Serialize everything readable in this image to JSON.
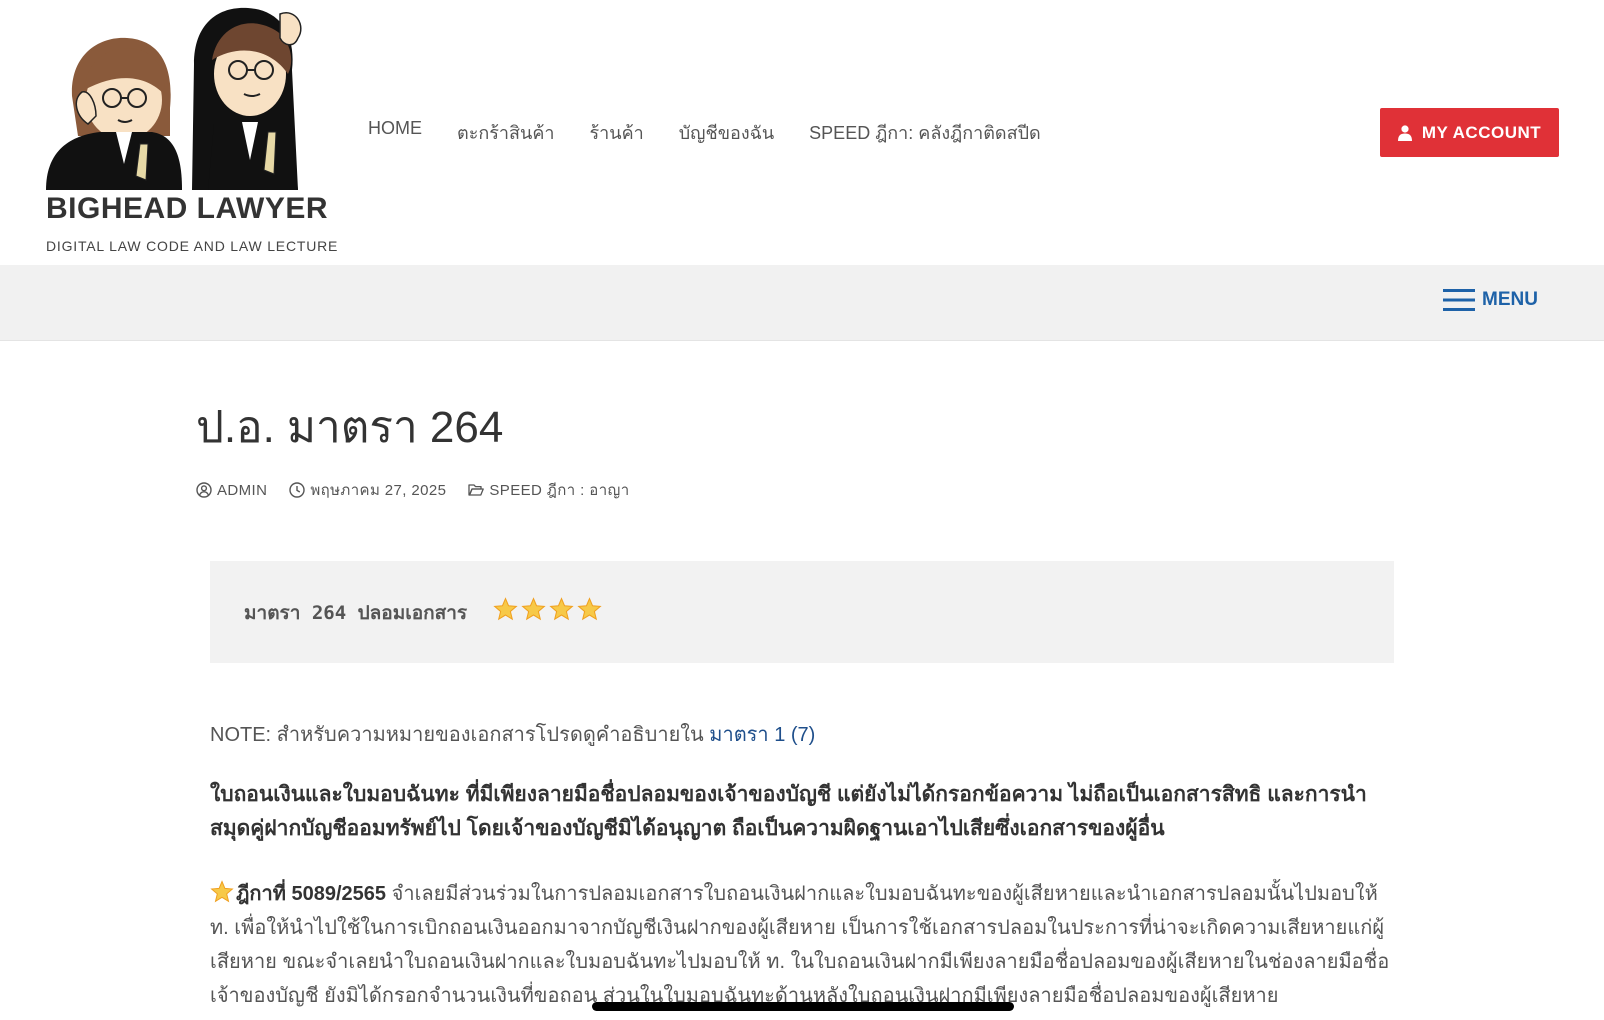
{
  "header": {
    "site_title": "BIGHEAD LAWYER",
    "site_tagline": "DIGITAL LAW CODE AND LAW LECTURE",
    "nav_items": [
      "HOME",
      "ตะกร้าสินค้า",
      "ร้านค้า",
      "บัญชีของฉัน",
      "SPEED ฎีกา: คลังฎีกาติดสปีด"
    ],
    "account_button": "MY ACCOUNT",
    "account_icon": "user-icon"
  },
  "menu_bar": {
    "label": "MENU",
    "icon": "hamburger-icon"
  },
  "article": {
    "title": "ป.อ. มาตรา 264",
    "meta": {
      "author": "ADMIN",
      "date": "พฤษภาคม 27, 2025",
      "category": "SPEED ฎีกา : อาญา"
    },
    "code_box": {
      "text": "มาตรา 264 ปลอมเอกสาร",
      "star_count": 4
    },
    "note": {
      "prefix": "NOTE: สำหรับความหมายของเอกสารโปรดดูคำอธิบายใน ",
      "link": "มาตรา 1 (7)"
    },
    "bold_paragraph": "ใบถอนเงินและใบมอบฉันทะ ที่มีเพียงลายมือชื่อปลอมของเจ้าของบัญชี แต่ยังไม่ได้กรอกข้อความ ไม่ถือเป็นเอกสารสิทธิ และการนำสมุดคู่ฝากบัญชีออมทรัพย์ไป โดยเจ้าของบัญชีมิได้อนุญาต ถือเป็นความผิดฐานเอาไปเสียซึ่งเอกสารของผู้อื่น",
    "case": {
      "number": "ฎีกาที่ 5089/2565",
      "text": " จำเลยมีส่วนร่วมในการปลอมเอกสารใบถอนเงินฝากและใบมอบฉันทะของผู้เสียหายและนำเอกสารปลอมนั้นไปมอบให้ ท. เพื่อให้นำไปใช้ในการเบิกถอนเงินออกมาจากบัญชีเงินฝากของผู้เสียหาย เป็นการใช้เอกสารปลอมในประการที่น่าจะเกิดความเสียหายแก่ผู้เสียหาย ขณะจำเลยนำใบถอนเงินฝากและใบมอบฉันทะไปมอบให้ ท. ในใบถอนเงินฝากมีเพียงลายมือชื่อปลอมของผู้เสียหายในช่องลายมือชื่อเจ้าของบัญชี ยังมิได้กรอกจำนวนเงินที่ขอถอน ส่วนในใบมอบฉันทะด้านหลังใบถอนเงินฝากมีเพียงลายมือชื่อปลอมของผู้เสียหาย"
    }
  },
  "colors": {
    "accent_button": "#e03137",
    "menu_blue": "#1e62a8",
    "link": "#1f4f8b",
    "star": "#f7c948"
  }
}
